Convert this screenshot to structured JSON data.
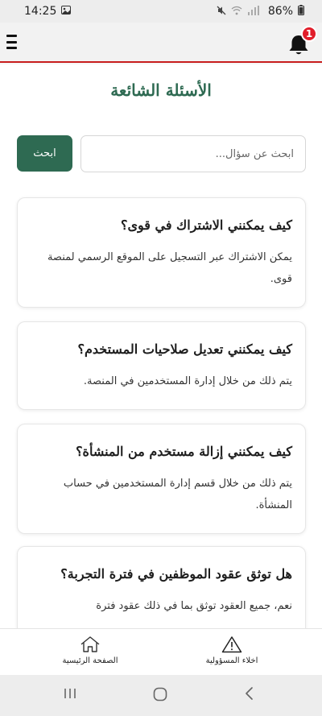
{
  "status_bar": {
    "time": "14:25",
    "battery": "86%"
  },
  "header": {
    "notification_count": "1"
  },
  "page": {
    "title": "الأسئلة الشائعة"
  },
  "search": {
    "placeholder": "ابحث عن سؤال...",
    "button_label": "ابحث"
  },
  "faqs": [
    {
      "question": "كيف يمكنني الاشتراك في قوى؟",
      "answer": "يمكن الاشتراك عبر التسجيل على الموقع الرسمي لمنصة قوى."
    },
    {
      "question": "كيف يمكنني تعديل صلاحيات المستخدم؟",
      "answer": "يتم ذلك من خلال إدارة المستخدمين في المنصة."
    },
    {
      "question": "كيف يمكنني إزالة مستخدم من المنشأة؟",
      "answer": "يتم ذلك من خلال قسم إدارة المستخدمين في حساب المنشأة."
    },
    {
      "question": "هل توثق عقود الموظفين في فترة التجربة؟",
      "answer": "نعم، جميع العقود توثق بما في ذلك عقود فترة"
    }
  ],
  "bottom_nav": {
    "home_label": "الصفحة الرئيسية",
    "disclaimer_label": "اخلاء المسؤولية"
  },
  "colors": {
    "accent": "#2e6a52",
    "header_border": "#c81e1e",
    "badge": "#e11d2a"
  },
  "icons": [
    "menu-icon",
    "bell-icon",
    "home-icon",
    "warning-icon",
    "recent-apps-icon",
    "home-circle-icon",
    "back-icon"
  ]
}
